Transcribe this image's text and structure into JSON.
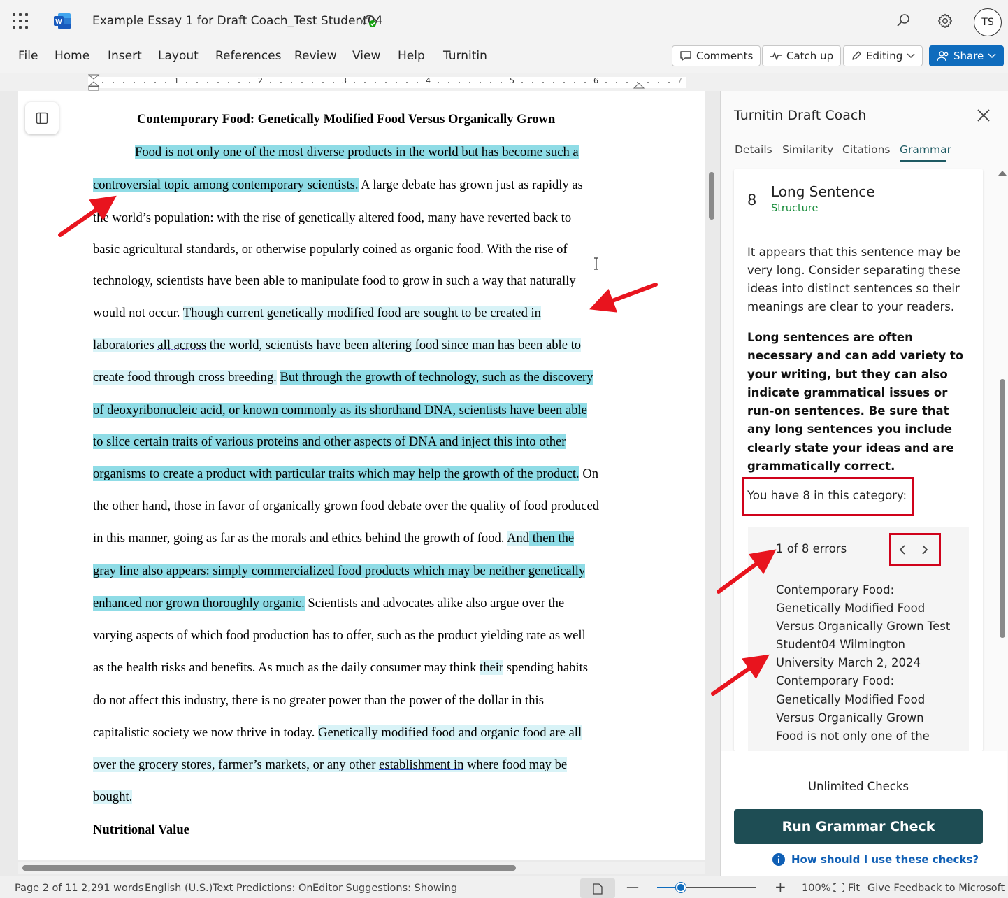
{
  "titlebar": {
    "doc_title": "Example Essay 1 for Draft Coach_Test Student04",
    "avatar_initials": "TS"
  },
  "ribbon": {
    "menu": [
      "File",
      "Home",
      "Insert",
      "Layout",
      "References",
      "Review",
      "View",
      "Help",
      "Turnitin"
    ],
    "comments_label": "Comments",
    "catchup_label": "Catch up",
    "editing_label": "Editing",
    "share_label": "Share"
  },
  "ruler": {
    "numbers": [
      "1",
      "2",
      "3",
      "4",
      "5",
      "6",
      "7"
    ]
  },
  "document": {
    "title": "Contemporary Food: Genetically Modified Food Versus Organically Grown",
    "lines": [
      [
        {
          "t": "Food is not only one of the most diverse products in the world but has become such a",
          "s": "hl-dark"
        }
      ],
      [
        {
          "t": "controversial topic among contemporary scientists.",
          "s": "hl-dark"
        },
        {
          "t": " A large debate has grown just as rapidly as",
          "s": ""
        }
      ],
      [
        {
          "t": "the world’s population: with the rise of genetically altered food, many have reverted back to",
          "s": ""
        }
      ],
      [
        {
          "t": "basic agricultural standards, or otherwise popularly coined as organic food. With the rise of",
          "s": ""
        }
      ],
      [
        {
          "t": "technology, scientists have been able to manipulate food to grow in such a way that naturally",
          "s": ""
        }
      ],
      [
        {
          "t": "would not occur. ",
          "s": ""
        },
        {
          "t": "Though current genetically modified food ",
          "s": "hl-light"
        },
        {
          "t": "are",
          "s": "hl-light ul-blue"
        },
        {
          "t": " sought to be created in ",
          "s": "hl-light"
        }
      ],
      [
        {
          "t": "laboratories ",
          "s": "hl-light"
        },
        {
          "t": "all across",
          "s": "hl-light ul-dotted"
        },
        {
          "t": " the world, scientists have been altering food since man has been able to ",
          "s": "hl-light"
        }
      ],
      [
        {
          "t": "create food through cross breeding.",
          "s": "hl-light"
        },
        {
          "t": " ",
          "s": ""
        },
        {
          "t": "But through the growth of technology, such as the discovery ",
          "s": "hl-dark"
        }
      ],
      [
        {
          "t": "of deoxyribonucleic acid, or known commonly as its shorthand DNA, scientists have been able ",
          "s": "hl-dark"
        }
      ],
      [
        {
          "t": "to slice certain traits of various proteins and other aspects of DNA and inject this into other ",
          "s": "hl-dark"
        }
      ],
      [
        {
          "t": "organisms to create a product with particular traits which may help the growth of the product.",
          "s": "hl-dark"
        },
        {
          "t": " On",
          "s": ""
        }
      ],
      [
        {
          "t": "the other hand, those in favor of organically grown food debate over the quality of food produced",
          "s": ""
        }
      ],
      [
        {
          "t": "in this manner, going as far as the morals and ethics behind the growth of food. ",
          "s": ""
        },
        {
          "t": "And",
          "s": "hl-light"
        },
        {
          "t": " then the ",
          "s": "hl-dark"
        }
      ],
      [
        {
          "t": "gray line also ",
          "s": "hl-dark"
        },
        {
          "t": "appears:",
          "s": "hl-dark ul-blue"
        },
        {
          "t": " simply commercialized food products which may be neither genetically ",
          "s": "hl-dark"
        }
      ],
      [
        {
          "t": "enhanced nor grown thoroughly organic.",
          "s": "hl-dark"
        },
        {
          "t": " Scientists and advocates alike also argue over the",
          "s": ""
        }
      ],
      [
        {
          "t": "varying aspects of which food production has to offer, such as the product yielding rate as well",
          "s": ""
        }
      ],
      [
        {
          "t": "as the health risks and benefits. As much as the daily consumer may think ",
          "s": ""
        },
        {
          "t": "their",
          "s": "hl-light"
        },
        {
          "t": " spending habits",
          "s": ""
        }
      ],
      [
        {
          "t": "do not affect this industry, there is no greater power than the power of the dollar in this",
          "s": ""
        }
      ],
      [
        {
          "t": "capitalistic society we now thrive in today. ",
          "s": ""
        },
        {
          "t": "Genetically modified food and organic food are all ",
          "s": "hl-light"
        }
      ],
      [
        {
          "t": "over the grocery stores, farmer’s markets, or any other ",
          "s": "hl-light"
        },
        {
          "t": "establishment in",
          "s": "hl-light ul-blue"
        },
        {
          "t": " where food may be ",
          "s": "hl-light"
        }
      ],
      [
        {
          "t": "bought.",
          "s": "hl-light"
        }
      ]
    ],
    "next_heading": "Nutritional Value"
  },
  "panel": {
    "title": "Turnitin Draft Coach",
    "tabs": [
      "Details",
      "Similarity",
      "Citations",
      "Grammar"
    ],
    "active_tab": "Grammar",
    "error_count": "8",
    "error_title": "Long Sentence",
    "error_category": "Structure",
    "description": "It appears that this sentence may be very long. Consider separating these ideas into distinct sentences so their meanings are clear to your readers.",
    "description_bold": "Long sentences are often necessary and can add variety to your writing, but they can also indicate grammatical issues or run-on sentences. Be sure that any long sentences you include clearly state your ideas and are grammatically correct.",
    "category_text": "You have 8 in this category:",
    "error_position": "1 of 8 errors",
    "excerpt": "Contemporary Food: Genetically Modified Food Versus Organically Grown Test Student04 Wilmington University March 2, 2024 Contemporary Food: Genetically Modified Food Versus Organically Grown Food is not only one of the most diverse products in the world",
    "unlimited_label": "Unlimited Checks",
    "run_button": "Run Grammar Check",
    "help_link": "How should I use these checks?"
  },
  "statusbar": {
    "page": "Page 2 of 11",
    "words": "2,291 words",
    "language": "English (U.S.)",
    "predictions": "Text Predictions: On",
    "editor": "Editor Suggestions: Showing",
    "zoom_minus": "—",
    "zoom_plus": "+",
    "zoom": "100%",
    "fit": "Fit",
    "feedback": "Give Feedback to Microsoft",
    "zoom_level": 0.24
  },
  "colors": {
    "highlight_dark": "#8fdce6",
    "highlight_light": "#d8f3f7",
    "accent": "#1e4d54",
    "share": "#0f6cbd",
    "annotation": "#d0021b",
    "category": "#138a36"
  }
}
